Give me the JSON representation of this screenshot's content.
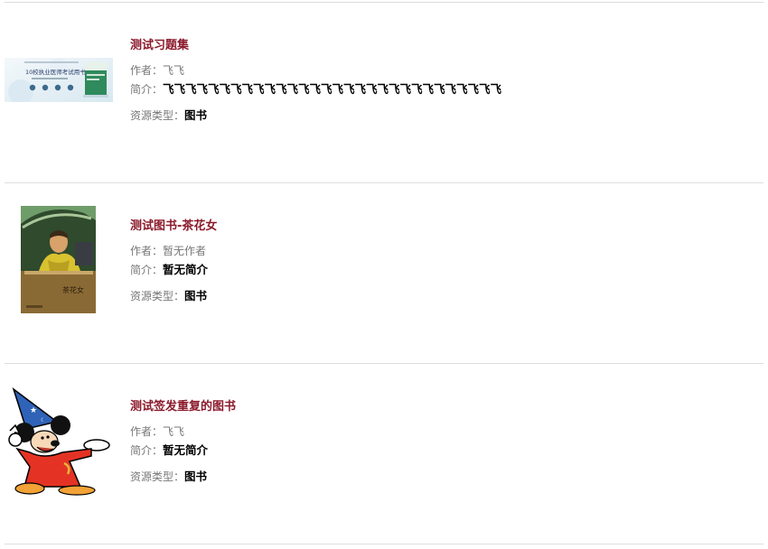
{
  "labels": {
    "author": "作者：",
    "summary": "简介：",
    "resource_type": "资源类型："
  },
  "items": [
    {
      "title": "测试习题集",
      "author": "飞飞",
      "summary": "飞飞飞飞飞飞飞飞飞飞飞飞飞飞飞飞飞飞飞飞飞飞飞飞飞飞飞飞飞飞",
      "resource_type": "图书",
      "cover_text": "10校执业医师考试用书"
    },
    {
      "title": "测试图书-茶花女",
      "author": "暂无作者",
      "summary": "暂无简介",
      "resource_type": "图书",
      "cover_text": "茶花女"
    },
    {
      "title": "测试签发重复的图书",
      "author": "飞飞",
      "summary": "暂无简介",
      "resource_type": "图书",
      "cover_text": ""
    }
  ],
  "colors": {
    "title": "#8b1a2b",
    "label": "#777777",
    "value": "#000000",
    "divider": "#dddddd"
  }
}
